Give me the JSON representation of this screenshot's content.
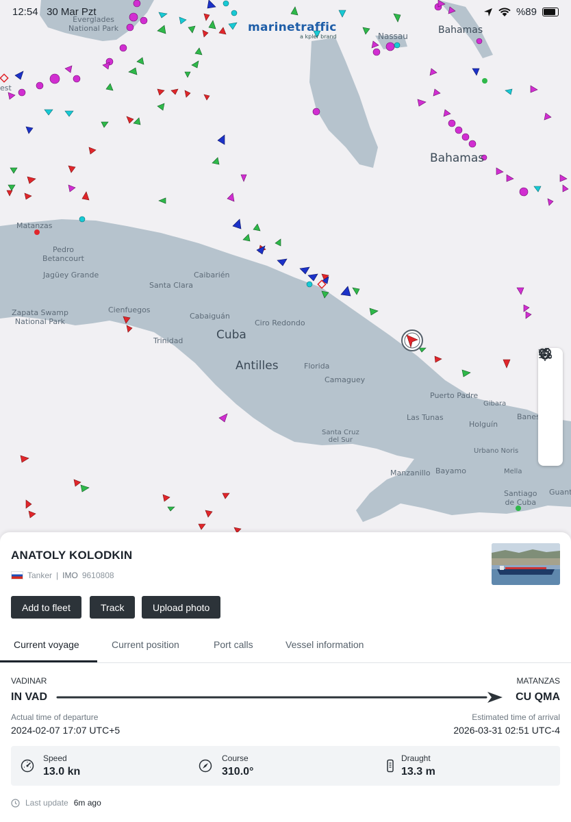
{
  "status_bar": {
    "time": "12:54",
    "date": "30 Mar Pzt",
    "battery": "%89"
  },
  "map": {
    "brand": {
      "name": "marinetraffic",
      "sub": "a kpler brand"
    },
    "labels": {
      "everglades": "Everglades\nNational Park",
      "nassau": "Nassau",
      "bahamas_top": "Bahamas",
      "bahamas": "Bahamas",
      "est": "est",
      "matanzas": "Matanzas",
      "pedro_betancourt": "Pedro\nBetancourt",
      "jaguey": "Jagüey Grande",
      "zapata": "Zapata Swamp\nNational Park",
      "santa_clara": "Santa Clara",
      "caibarien": "Caibarién",
      "cienfuegos": "Cienfuegos",
      "cabaiguan": "Cabaiguán",
      "trinidad": "Trinidad",
      "ciro_redondo": "Ciro Redondo",
      "cuba": "Cuba",
      "antilles": "Antilles",
      "florida": "Florida",
      "camaguey": "Camaguey",
      "puerto_padre": "Puerto Padre",
      "gibara": "Gibara",
      "las_tunas": "Las Tunas",
      "banes": "Banes",
      "holguin": "Holguín",
      "santa_cruz": "Santa Cruz\ndel Sur",
      "urbano_noris": "Urbano Noris",
      "manzanillo": "Manzanillo",
      "bayamo": "Bayamo",
      "mella": "Mella",
      "santiago": "Santiago\nde Cuba",
      "guant": "Guant"
    },
    "tools": [
      "wind-icon",
      "heart-icon",
      "filter-icon",
      "locate-icon"
    ]
  },
  "vessel": {
    "name": "ANATOLY KOLODKIN",
    "type": "Tanker",
    "imo_label": "IMO",
    "imo": "9610808",
    "flag": "russia"
  },
  "actions": {
    "add_fleet": "Add to fleet",
    "track": "Track",
    "upload_photo": "Upload photo"
  },
  "tabs": [
    "Current voyage",
    "Current position",
    "Port calls",
    "Vessel information"
  ],
  "voyage": {
    "from_name": "VADINAR",
    "from_code": "IN VAD",
    "to_name": "MATANZAS",
    "to_code": "CU QMA",
    "atd_label": "Actual time of departure",
    "atd": "2024-02-07 17:07 UTC+5",
    "eta_label": "Estimated time of arrival",
    "eta": "2026-03-31 02:51 UTC-4"
  },
  "stats": {
    "speed_label": "Speed",
    "speed": "13.0 kn",
    "course_label": "Course",
    "course": "310.0°",
    "draught_label": "Draught",
    "draught": "13.3 m"
  },
  "last_update": {
    "label": "Last update",
    "value": "6m ago"
  },
  "colors": {
    "water": "#f1f0f3",
    "land": "#b6c3cd",
    "tanker": "#e0262b",
    "cargo": "#2fb84a",
    "passenger": "#1c32c8",
    "pleasure": "#d12ed1",
    "tug": "#18c9d4",
    "button": "#2c3339"
  }
}
